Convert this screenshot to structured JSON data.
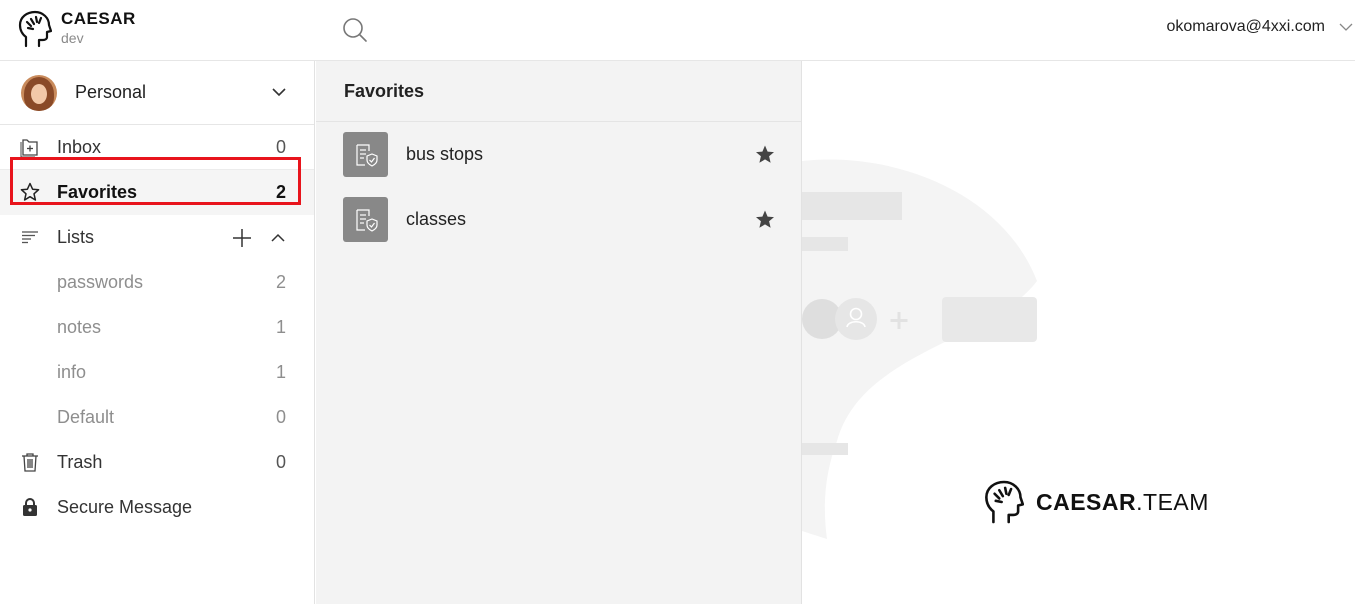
{
  "header": {
    "app_name": "CAESAR",
    "app_env": "dev",
    "user_email": "okomarova@4xxi.com"
  },
  "workspace": {
    "name": "Personal"
  },
  "sidebar": {
    "items": [
      {
        "label": "Inbox",
        "count": "0",
        "icon": "inbox-icon"
      },
      {
        "label": "Favorites",
        "count": "2",
        "icon": "star-outline-icon"
      },
      {
        "label": "Lists",
        "icon": "lists-icon"
      },
      {
        "label": "passwords",
        "count": "2"
      },
      {
        "label": "notes",
        "count": "1"
      },
      {
        "label": "info",
        "count": "1"
      },
      {
        "label": "Default",
        "count": "0"
      },
      {
        "label": "Trash",
        "count": "0",
        "icon": "trash-icon"
      },
      {
        "label": "Secure Message",
        "icon": "lock-icon"
      }
    ]
  },
  "middle": {
    "title": "Favorites",
    "items": [
      {
        "label": "bus stops",
        "icon": "credential-icon",
        "starred": true
      },
      {
        "label": "classes",
        "icon": "credential-icon",
        "starred": true
      }
    ]
  },
  "right": {
    "brand_bold": "CAESAR",
    "brand_light": ".TEAM"
  },
  "colors": {
    "highlight": "#e8141c",
    "item_icon_bg": "#888888",
    "middle_bg": "#f3f3f3"
  }
}
